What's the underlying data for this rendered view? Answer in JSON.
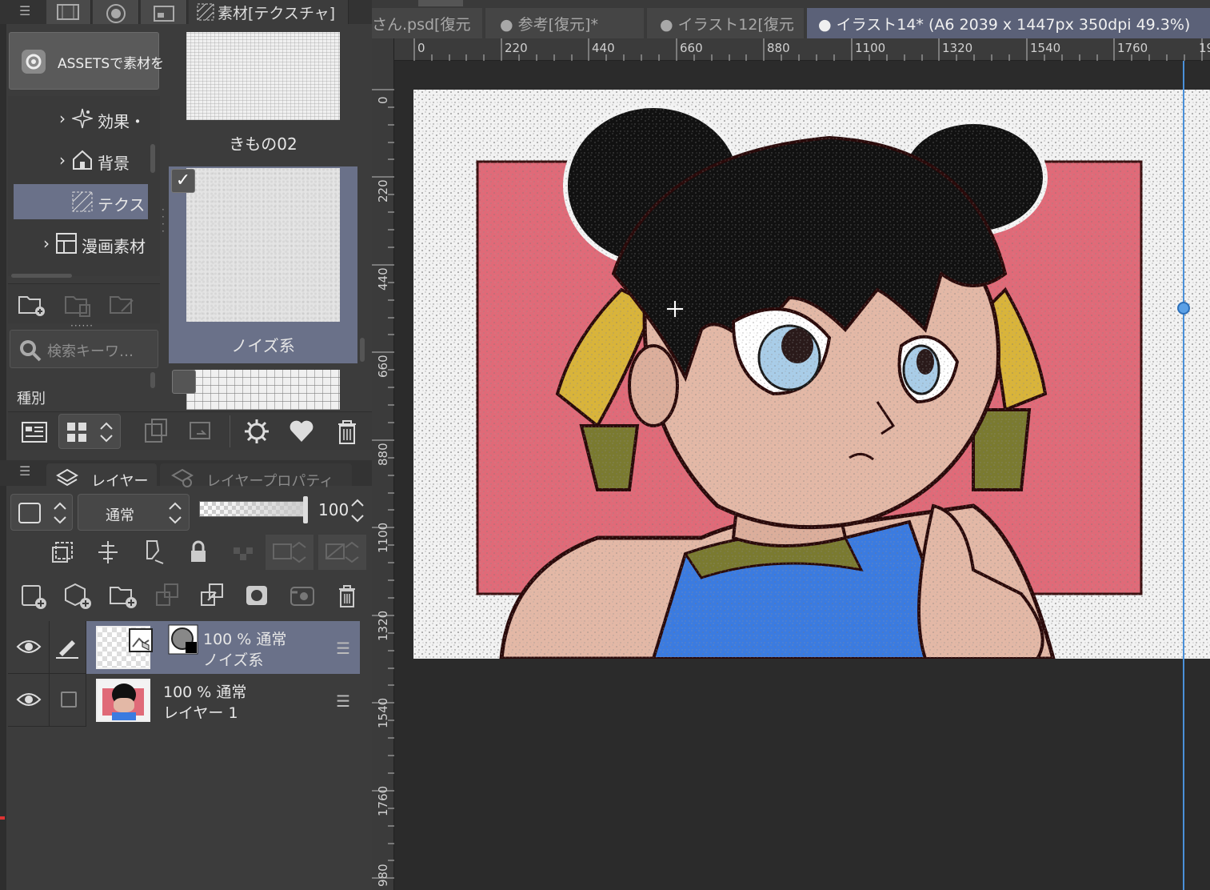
{
  "material_panel": {
    "tab_title": "素材[テクスチャ]",
    "assets_button": "ASSETSで素材を",
    "tree": [
      {
        "label": "効果・",
        "icon": "sparkle-icon",
        "selected": false
      },
      {
        "label": "背景",
        "icon": "house-icon",
        "selected": false
      },
      {
        "label": "テクス",
        "icon": "texture-icon",
        "selected": true
      },
      {
        "label": "漫画素材",
        "icon": "manga-frame-icon",
        "selected": false
      }
    ],
    "search_placeholder": "検索キーワ…",
    "kind_label": "種別",
    "materials": [
      {
        "label": "きもの02",
        "selected": false
      },
      {
        "label": "ノイズ系",
        "selected": true,
        "checked": true
      },
      {
        "label": "",
        "selected": false
      }
    ]
  },
  "layer_panel": {
    "tabs": [
      {
        "label": "レイヤー",
        "active": true
      },
      {
        "label": "レイヤープロパティ",
        "active": false
      }
    ],
    "blend_mode": "通常",
    "opacity": "100",
    "layers": [
      {
        "line1": "100 %  通常",
        "line2": "ノイズ系",
        "selected": true,
        "visible": true
      },
      {
        "line1": "100 %  通常",
        "line2": "レイヤー 1",
        "selected": false,
        "visible": true
      }
    ]
  },
  "document_tabs": [
    {
      "label": "さん.psd[復元",
      "active": false
    },
    {
      "label": "●  参考[復元]*",
      "active": false
    },
    {
      "label": "●  イラスト12[復元",
      "active": false
    },
    {
      "label": "●  イラスト14* (A6 2039 x 1447px 350dpi 49.3%)",
      "active": true
    }
  ],
  "rulers": {
    "horizontal": [
      "0",
      "220",
      "440",
      "660",
      "880",
      "1100",
      "1320",
      "1540",
      "1760",
      "19"
    ],
    "vertical": [
      "0",
      "220",
      "440",
      "660",
      "880",
      "1100",
      "1320",
      "1540",
      "1760",
      "980"
    ]
  },
  "colors": {
    "accent": "#6a7189",
    "active_tab": "#5b6178",
    "guide": "#4a90d9",
    "panel_bg": "#3c3c3c"
  }
}
